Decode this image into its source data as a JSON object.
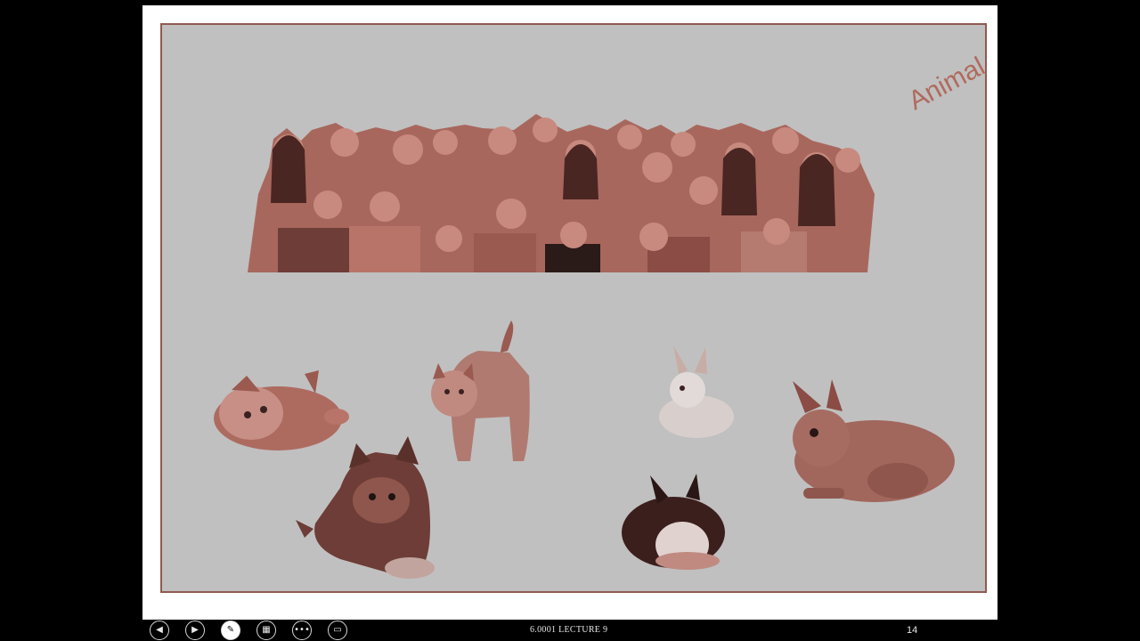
{
  "slide": {
    "title": "Animal",
    "images": [
      "people-group",
      "kitten",
      "kitten",
      "kitten",
      "rabbit",
      "rabbit",
      "rabbit"
    ]
  },
  "controls": {
    "previous_icon": "◀",
    "next_icon": "▶",
    "pen_icon": "✎",
    "view_icon": "▦",
    "more_icon": "•••",
    "screen_icon": "▭"
  },
  "footer": {
    "lecture": "6.0001 LECTURE 9",
    "slide_number": "14"
  },
  "colors": {
    "slide_bg": "#c0c0c0",
    "accent": "#b06a5e",
    "frame": "#8f5a50"
  }
}
